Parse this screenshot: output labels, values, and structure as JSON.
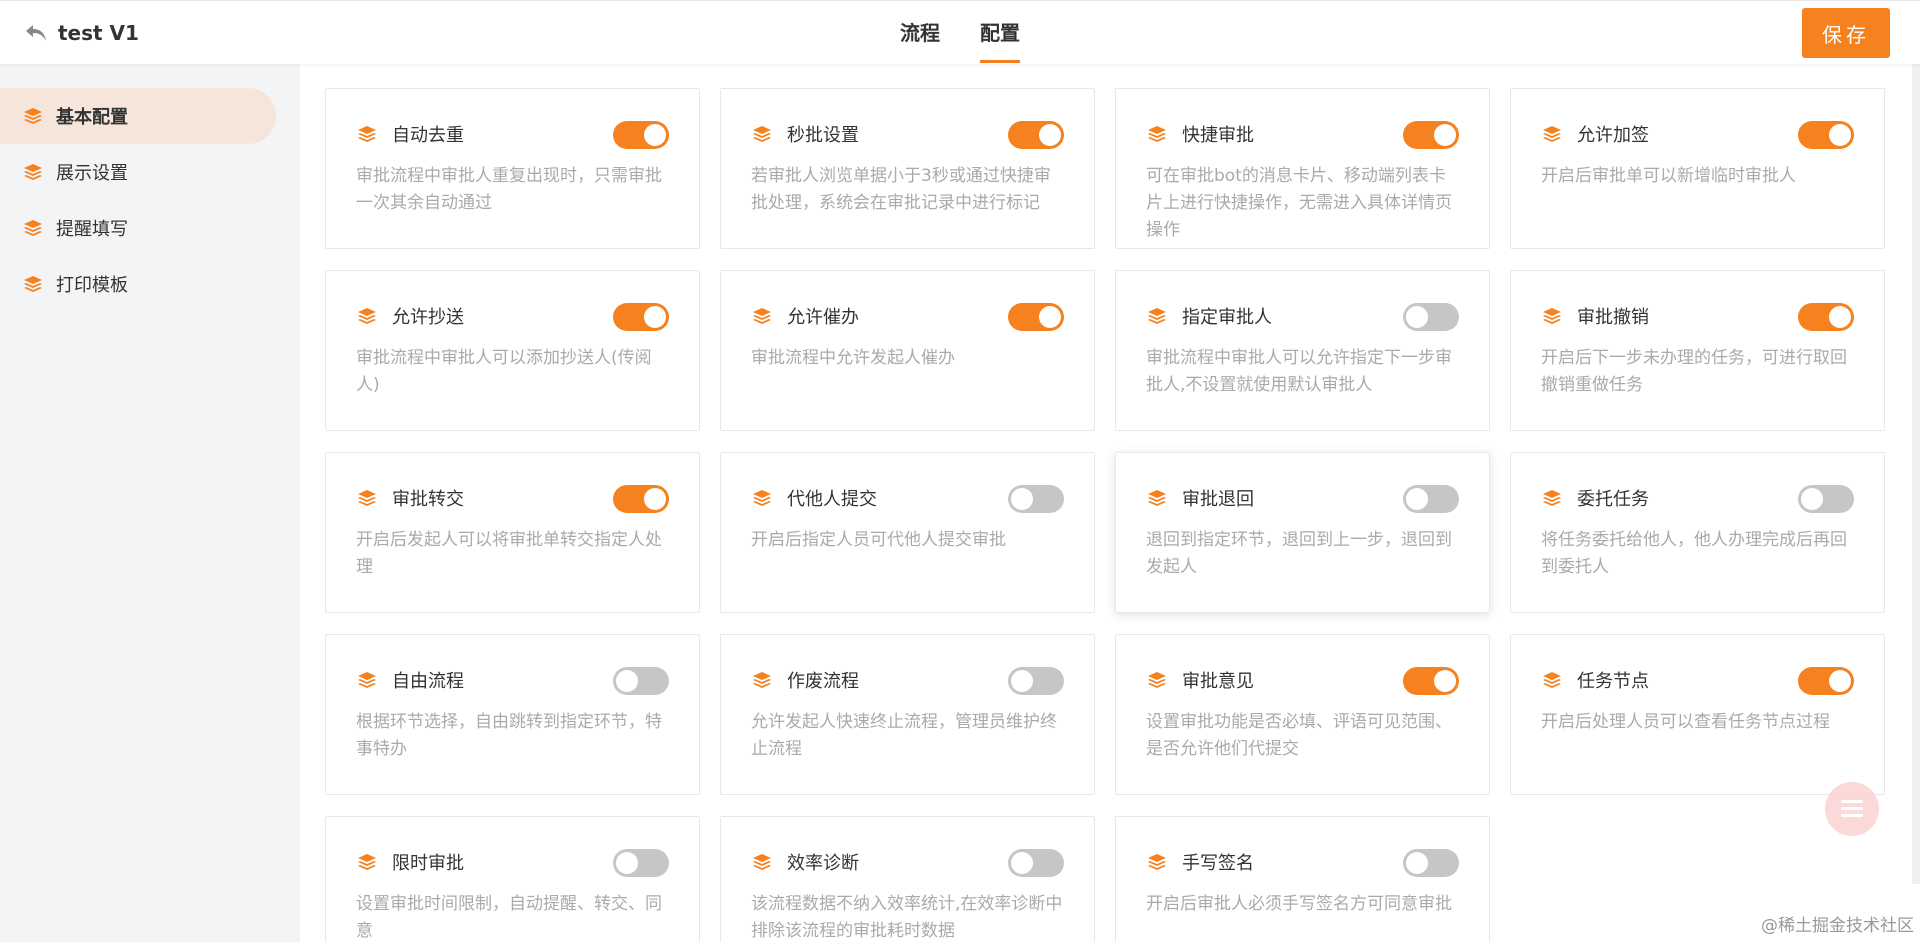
{
  "header": {
    "title": "test V1",
    "tabs": [
      {
        "label": "流程"
      },
      {
        "label": "配置"
      }
    ],
    "active_tab": "配置",
    "save_label": "保存"
  },
  "sidebar": {
    "items": [
      {
        "label": "基本配置",
        "active": true
      },
      {
        "label": "展示设置",
        "active": false
      },
      {
        "label": "提醒填写",
        "active": false
      },
      {
        "label": "打印模板",
        "active": false
      }
    ]
  },
  "cards": [
    {
      "title": "自动去重",
      "desc": "审批流程中审批人重复出现时，只需审批一次其余自动通过",
      "on": true
    },
    {
      "title": "秒批设置",
      "desc": "若审批人浏览单据小于3秒或通过快捷审批处理，系统会在审批记录中进行标记",
      "on": true
    },
    {
      "title": "快捷审批",
      "desc": "可在审批bot的消息卡片、移动端列表卡片上进行快捷操作，无需进入具体详情页操作",
      "on": true
    },
    {
      "title": "允许加签",
      "desc": "开启后审批单可以新增临时审批人",
      "on": true
    },
    {
      "title": "允许抄送",
      "desc": "审批流程中审批人可以添加抄送人(传阅人)",
      "on": true
    },
    {
      "title": "允许催办",
      "desc": "审批流程中允许发起人催办",
      "on": true
    },
    {
      "title": "指定审批人",
      "desc": "审批流程中审批人可以允许指定下一步审批人,不设置就使用默认审批人",
      "on": false
    },
    {
      "title": "审批撤销",
      "desc": "开启后下一步未办理的任务，可进行取回撤销重做任务",
      "on": true
    },
    {
      "title": "审批转交",
      "desc": "开启后发起人可以将审批单转交指定人处理",
      "on": true
    },
    {
      "title": "代他人提交",
      "desc": "开启后指定人员可代他人提交审批",
      "on": false
    },
    {
      "title": "审批退回",
      "desc": "退回到指定环节，退回到上一步，退回到发起人",
      "on": false
    },
    {
      "title": "委托任务",
      "desc": "将任务委托给他人，他人办理完成后再回到委托人",
      "on": false
    },
    {
      "title": "自由流程",
      "desc": "根据环节选择，自由跳转到指定环节，特事特办",
      "on": false
    },
    {
      "title": "作废流程",
      "desc": "允许发起人快速终止流程，管理员维护终止流程",
      "on": false
    },
    {
      "title": "审批意见",
      "desc": "设置审批功能是否必填、评语可见范围、是否允许他们代提交",
      "on": true
    },
    {
      "title": "任务节点",
      "desc": "开启后处理人员可以查看任务节点过程",
      "on": true
    },
    {
      "title": "限时审批",
      "desc": "设置审批时间限制，自动提醒、转交、同意",
      "on": false
    },
    {
      "title": "效率诊断",
      "desc": "该流程数据不纳入效率统计,在效率诊断中排除该流程的审批耗时数据",
      "on": false
    },
    {
      "title": "手写签名",
      "desc": "开启后审批人必须手写签名方可同意审批",
      "on": false
    }
  ],
  "watermark": "@稀土掘金技术社区",
  "colors": {
    "accent": "#f5821f",
    "toggle_off": "#c6c6c6"
  }
}
